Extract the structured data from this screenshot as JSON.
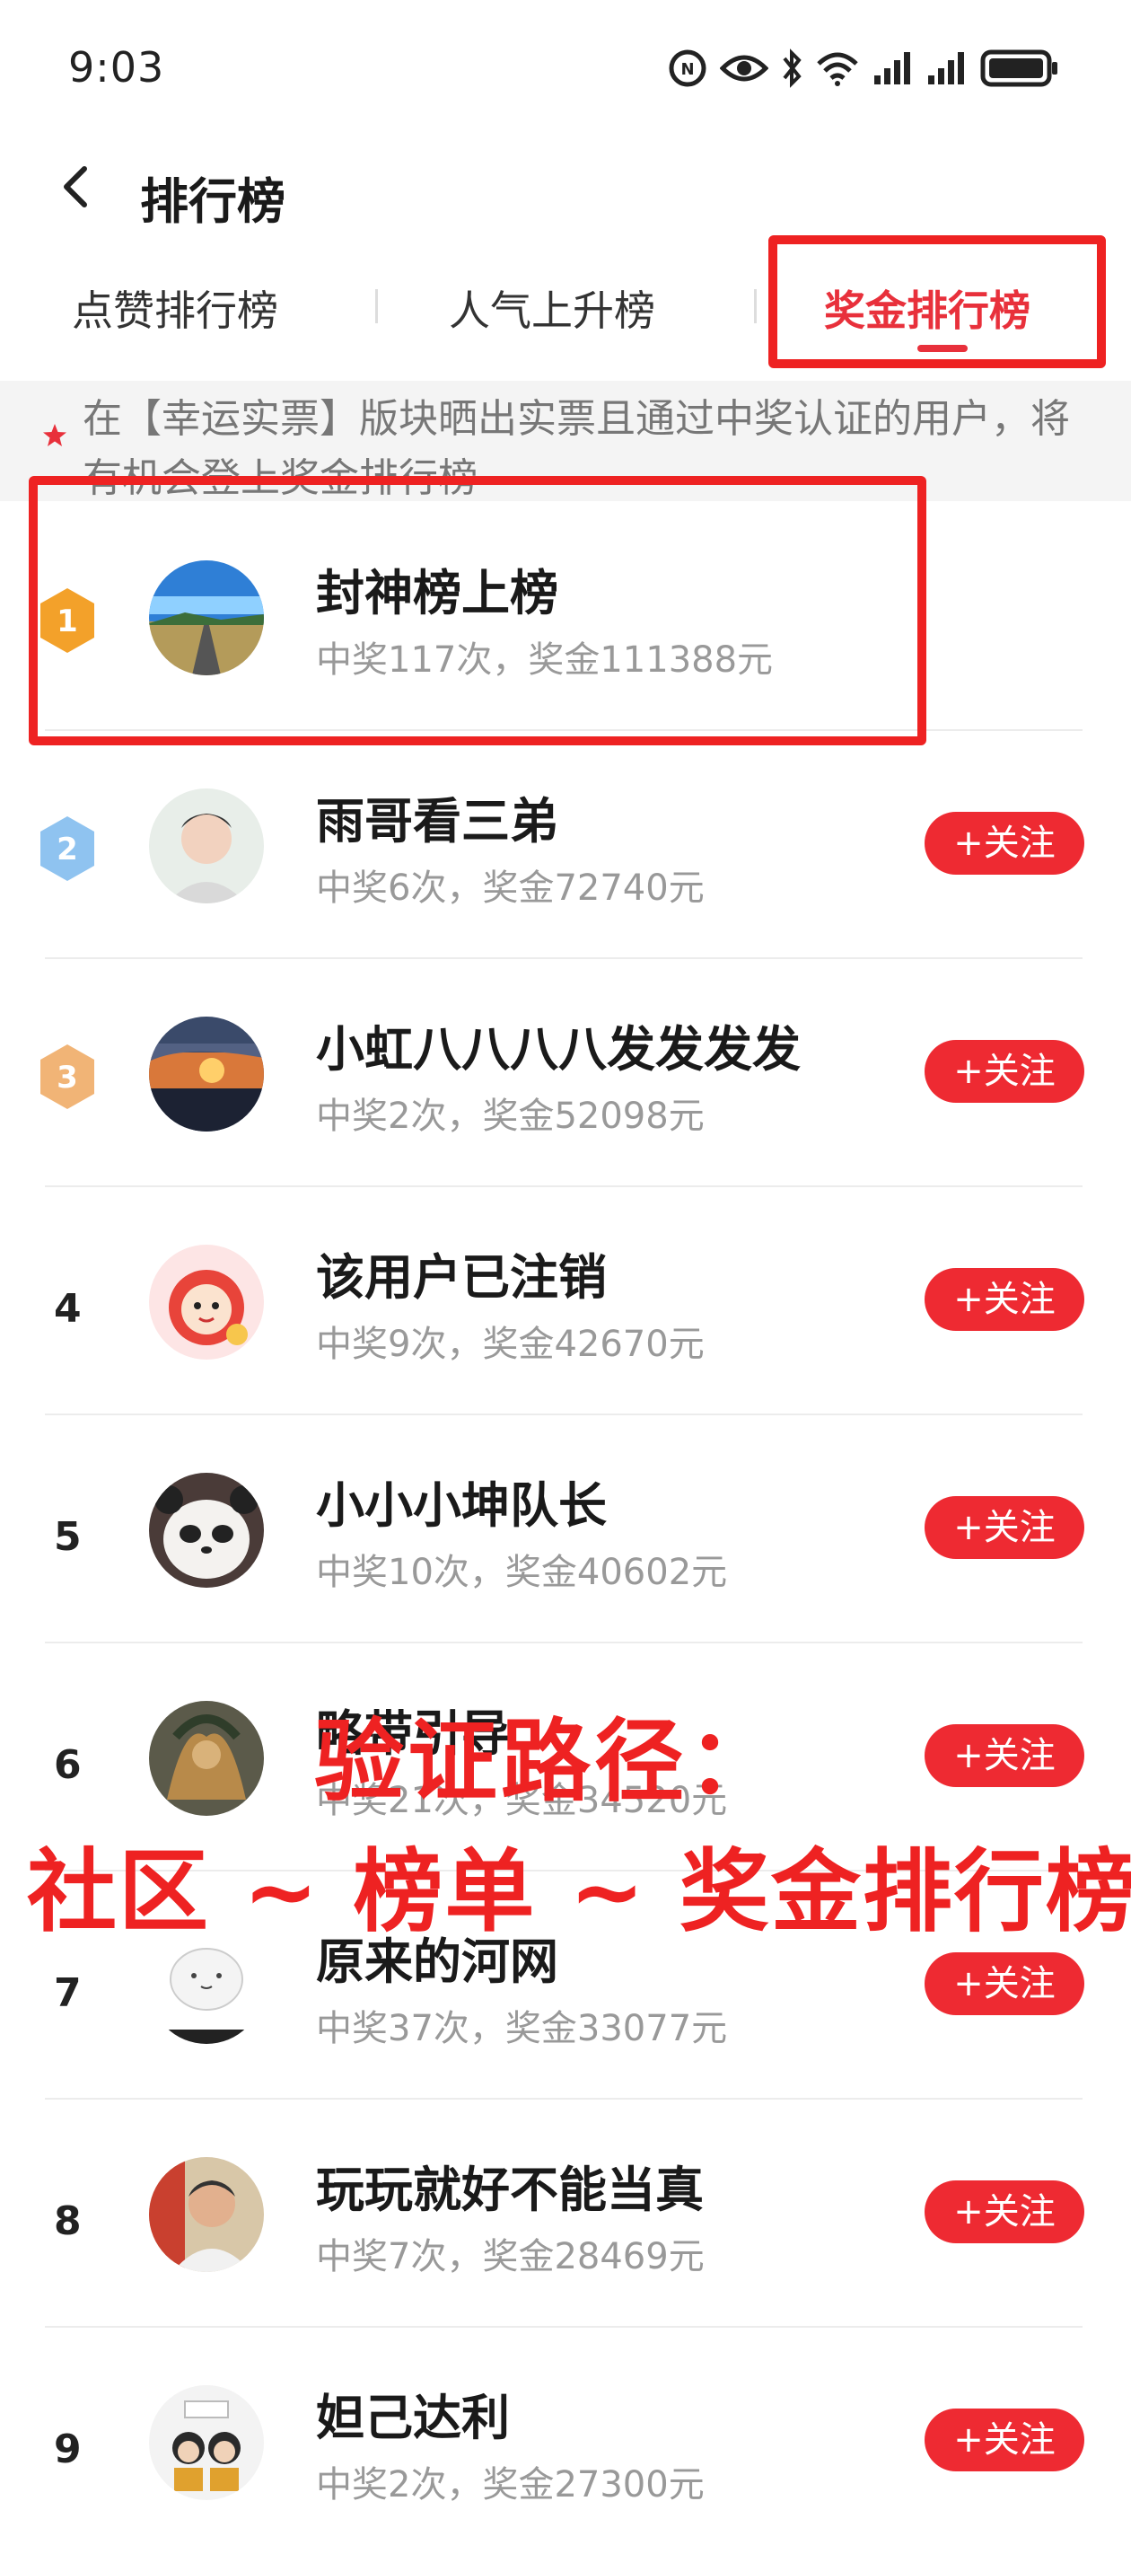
{
  "status_bar": {
    "time": "9:03"
  },
  "header": {
    "title": "排行榜"
  },
  "tabs": [
    {
      "label": "点赞排行榜",
      "active": false
    },
    {
      "label": "人气上升榜",
      "active": false
    },
    {
      "label": "奖金排行榜",
      "active": true
    }
  ],
  "notice": {
    "text": "在【幸运实票】版块晒出实票且通过中奖认证的用户，将有机会登上奖金排行榜"
  },
  "ranking": [
    {
      "rank": "1",
      "name": "封神榜上榜",
      "stats": "中奖117次，奖金111388元",
      "follow_label": ""
    },
    {
      "rank": "2",
      "name": "雨哥看三弟",
      "stats": "中奖6次，奖金72740元",
      "follow_label": "+关注"
    },
    {
      "rank": "3",
      "name": "小虹八八八八发发发发",
      "stats": "中奖2次，奖金52098元",
      "follow_label": "+关注"
    },
    {
      "rank": "4",
      "name": "该用户已注销",
      "stats": "中奖9次，奖金42670元",
      "follow_label": "+关注"
    },
    {
      "rank": "5",
      "name": "小小小坤队长",
      "stats": "中奖10次，奖金40602元",
      "follow_label": "+关注"
    },
    {
      "rank": "6",
      "name": "略带引导",
      "stats": "中奖21次，奖金34520元",
      "follow_label": "+关注"
    },
    {
      "rank": "7",
      "name": "原来的河网",
      "stats": "中奖37次，奖金33077元",
      "follow_label": "+关注"
    },
    {
      "rank": "8",
      "name": "玩玩就好不能当真",
      "stats": "中奖7次，奖金28469元",
      "follow_label": "+关注"
    },
    {
      "rank": "9",
      "name": "妲己达利",
      "stats": "中奖2次，奖金27300元",
      "follow_label": "+关注"
    }
  ],
  "overlay": {
    "line1": "验证路径：",
    "line2": "社区 ~ 榜单 ~ 奖金排行榜"
  },
  "colors": {
    "accent": "#e8303b",
    "highlight": "#ee2222",
    "gold": "#f3a12a",
    "silver": "#8fc3f0",
    "bronze": "#f1b476"
  }
}
